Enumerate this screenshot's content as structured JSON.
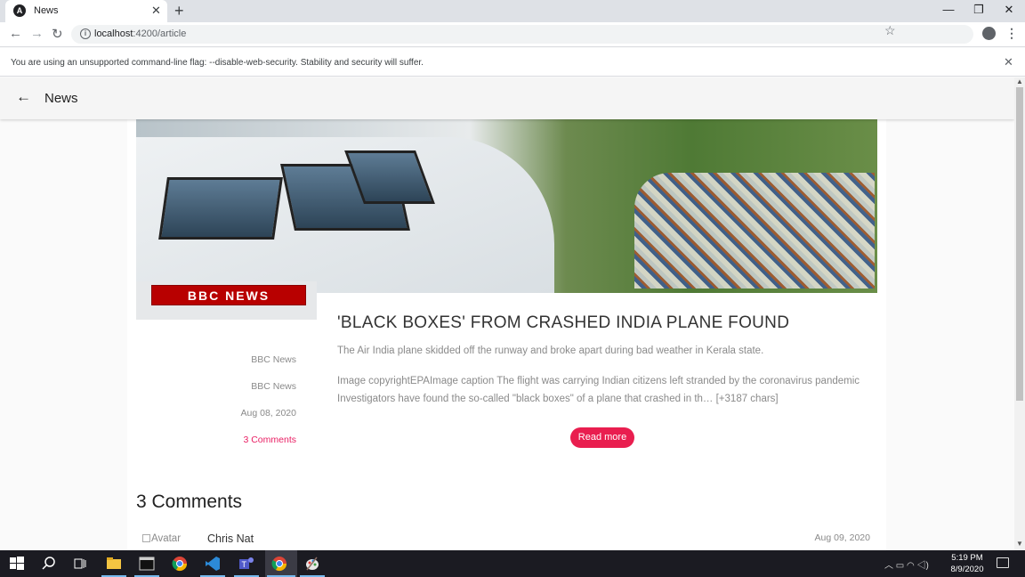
{
  "browser": {
    "tab_title": "News",
    "tab_favicon": "A",
    "new_tab_symbol": "+",
    "url_host": "localhost",
    "url_rest": ":4200/article",
    "warning": "You are using an unsupported command-line flag: --disable-web-security. Stability and security will suffer."
  },
  "app": {
    "title": "News"
  },
  "article": {
    "logo_text": "BBC NEWS",
    "headline": "'BLACK BOXES' FROM CRASHED INDIA PLANE FOUND",
    "description": "The Air India plane skidded off the runway and broke apart during bad weather in Kerala state.",
    "content": "Image copyrightEPAImage caption The flight was carrying Indian citizens left stranded by the coronavirus pandemic Investigators have found the so-called \"black boxes\" of a plane that crashed in th… [+3187 chars]",
    "source": "BBC News",
    "author": "BBC News",
    "date": "Aug 08, 2020",
    "comments_link": "3 Comments",
    "read_more": "Read more"
  },
  "comments": {
    "heading": "3 Comments",
    "items": [
      {
        "avatar_alt": "Avatar",
        "name": "Chris Nat",
        "date": "Aug 09, 2020"
      }
    ]
  },
  "taskbar": {
    "time": "5:19 PM",
    "date": "8/9/2020"
  },
  "colors": {
    "accent": "#e91e4f",
    "bbc_red": "#b80000",
    "taskbar": "#1b1b22"
  }
}
